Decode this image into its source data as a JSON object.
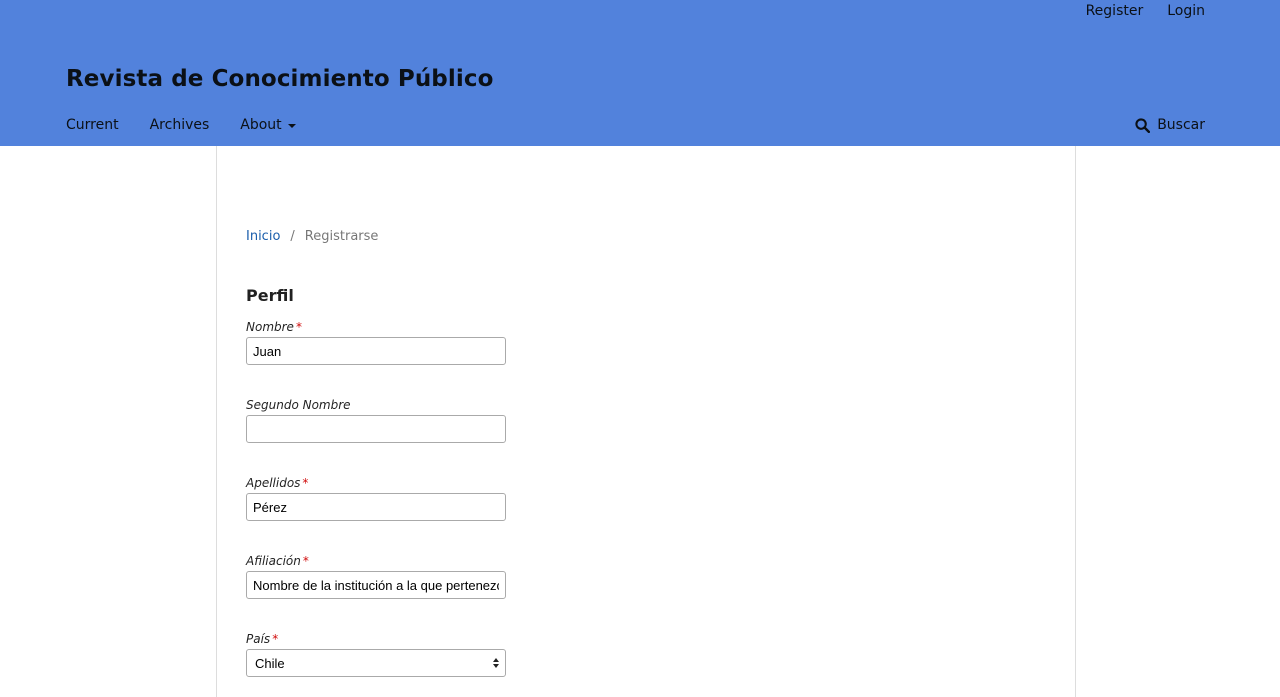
{
  "header": {
    "site_title": "Revista de Conocimiento Público",
    "user_nav": {
      "register": "Register",
      "login": "Login"
    },
    "primary_nav": {
      "current": "Current",
      "archives": "Archives",
      "about": "About"
    },
    "search": {
      "label": "Buscar",
      "icon": "search-icon"
    },
    "background_color": "#5282dc"
  },
  "breadcrumb": {
    "home": "Inicio",
    "separator": "/",
    "current": "Registrarse"
  },
  "form": {
    "section_title": "Perfil",
    "required_marker": "*",
    "fields": {
      "nombre": {
        "label": "Nombre",
        "value": "Juan",
        "required": true
      },
      "segundo_nombre": {
        "label": "Segundo Nombre",
        "value": "",
        "required": false
      },
      "apellidos": {
        "label": "Apellidos",
        "value": "Pérez",
        "required": true
      },
      "afiliacion": {
        "label": "Afiliación",
        "value": "Nombre de la institución a la que pertenezca",
        "required": true
      },
      "pais": {
        "label": "País",
        "value": "Chile",
        "required": true
      }
    }
  }
}
